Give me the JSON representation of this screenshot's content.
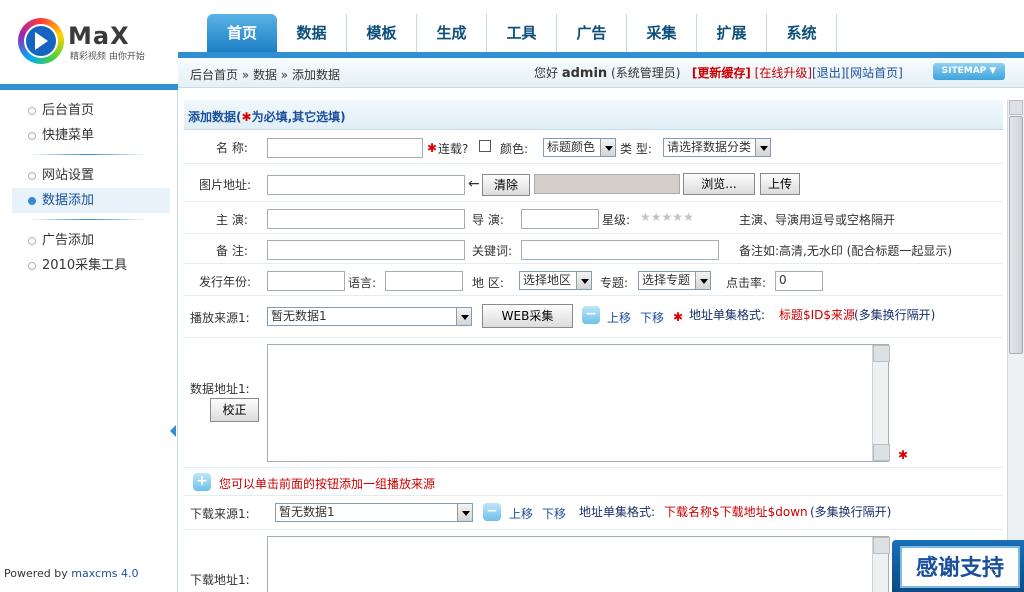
{
  "logo": {
    "mark": "MaX",
    "slogan": "精彩视频 由你开始"
  },
  "nav": [
    "首页",
    "数据",
    "模板",
    "生成",
    "工具",
    "广告",
    "采集",
    "扩展",
    "系统"
  ],
  "breadcrumb": "后台首页 » 数据 » 添加数据",
  "user": {
    "greet": "您好",
    "name": "admin",
    "role": "(系统管理员)",
    "refresh": "[更新缓存]",
    "upgrade": "[在线升级]",
    "logout": "[退出]",
    "home": "[网站首页]",
    "sitemap": "SITEMAP ▼"
  },
  "sidebar": {
    "group1": [
      "后台首页",
      "快捷菜单"
    ],
    "group2": [
      "网站设置",
      "数据添加"
    ],
    "group3": [
      "广告添加",
      "2010采集工具"
    ],
    "powered_prefix": "Powered by ",
    "powered_link": "maxcms 4.0"
  },
  "form": {
    "header_prefix": "添加数据(",
    "header_req": "✱",
    "header_suffix": "为必填,其它选填)",
    "name_label": "名  称:",
    "serial_label": "连载?",
    "color_label": "颜色:",
    "color_select": "标题颜色",
    "type_label": "类 型:",
    "type_select": "请选择数据分类",
    "pic_label": "图片地址:",
    "clear_btn": "清除",
    "browse_btn": "浏览...",
    "upload_btn": "上传",
    "actor_label": "主  演:",
    "director_label": "导  演:",
    "star_label": "星级:",
    "actor_note": "主演、导演用逗号或空格隔开",
    "remark_label": "备  注:",
    "keyword_label": "关键词:",
    "remark_note": "备注如:高清,无水印 (配合标题一起显示)",
    "year_label": "发行年份:",
    "lang_label": "语言:",
    "area_label": "地  区:",
    "area_select": "选择地区",
    "topic_label": "专题:",
    "topic_select": "选择专题",
    "hits_label": "点击率:",
    "hits_value": "0",
    "play_label": "播放来源1:",
    "play_select": "暂无数据1",
    "web_btn": "WEB采集",
    "up_link": "上移",
    "down_link": "下移",
    "addr_fmt_label": "地址单集格式:",
    "play_fmt": "标题$ID$来源",
    "play_fmt_note": "(多集换行隔开)",
    "data_addr_label": "数据地址1:",
    "correct_btn": "校正",
    "add_play_tip": "您可以单击前面的按钮添加一组播放来源",
    "dl_label": "下载来源1:",
    "dl_select": "暂无数据1",
    "dl_fmt": "下载名称$下载地址$down",
    "dl_fmt_note": "(多集换行隔开)",
    "dl_addr_label": "下载地址1:"
  },
  "thanks": "感谢支持",
  "colors": {
    "accent": "#2f8fd0",
    "nav_text": "#0b4f7a",
    "required": "#dd0000",
    "link_blue": "#1a4f9c"
  }
}
